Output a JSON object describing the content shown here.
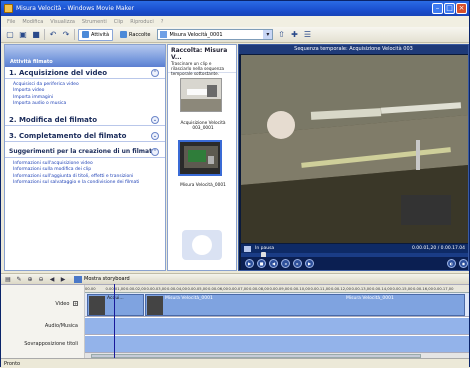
{
  "window": {
    "title": "Misura Velocità - Windows Movie Maker"
  },
  "menu": [
    "File",
    "Modifica",
    "Visualizza",
    "Strumenti",
    "Clip",
    "Riproduci",
    "?"
  ],
  "toolbar": {
    "tasks_label": "Attività",
    "collections_label": "Raccolte",
    "collection_value": "Misura Velocità_0001"
  },
  "task_pane": {
    "header": "Attività filmato",
    "sections": [
      {
        "title": "1. Acquisizione del video",
        "items": [
          "Acquisisci da periferica video",
          "Importa video",
          "Importa immagini",
          "Importa audio o musica"
        ]
      },
      {
        "title": "2. Modifica del filmato",
        "items": []
      },
      {
        "title": "3. Completamento del filmato",
        "items": []
      },
      {
        "title": "Suggerimenti per la creazione di un filmato",
        "items": [
          "Informazioni sull'acquisizione video",
          "Informazioni sulla modifica dei clip",
          "Informazioni sull'aggiunta di titoli, effetti e transizioni",
          "Informazioni sul salvataggio e la condivisione dei filmati"
        ]
      }
    ]
  },
  "collection": {
    "title": "Raccolta: Misura V...",
    "hint": "Trascinare un clip e rilasciarlo nella sequenza temporale sottostante.",
    "clips": [
      {
        "label": "Acquisizione Velocità 003_0001"
      },
      {
        "label": "Misura Velocità_0001"
      }
    ]
  },
  "monitor": {
    "title": "Sequenza temporale: Acquisizione Velocità 003",
    "status": "In pausa",
    "time": "0.00.01,20 / 0.00.17.04"
  },
  "storyboard": {
    "label": "Mostra storyboard"
  },
  "timeline": {
    "ruler": [
      "00.00",
      "0.00.01,00",
      "0.00.02,00",
      "0.00.03,00",
      "0.00.04,00",
      "0.00.05,00",
      "0.00.06,00",
      "0.00.07,00",
      "0.00.08,00",
      "0.00.09,00",
      "0.00.10,00",
      "0.00.11,00",
      "0.00.12,00",
      "0.00.13,00",
      "0.00.14,00",
      "0.00.15,00",
      "0.00.16,00",
      "0.00.17,00"
    ],
    "tracks": {
      "video": "Video",
      "audio": "Audio/Musica",
      "overlay": "Sovrapposizione titoli"
    },
    "clips": [
      {
        "label": "Acqui..."
      },
      {
        "label": "Misura Velocità_0001"
      },
      {
        "label": "Misura Velocità_0001"
      }
    ]
  },
  "statusbar": {
    "text": "Pronto"
  },
  "colors": {
    "titlebar": "#1a4fcf",
    "task_header": "#6b8fd9",
    "track": "#93b3ea"
  }
}
